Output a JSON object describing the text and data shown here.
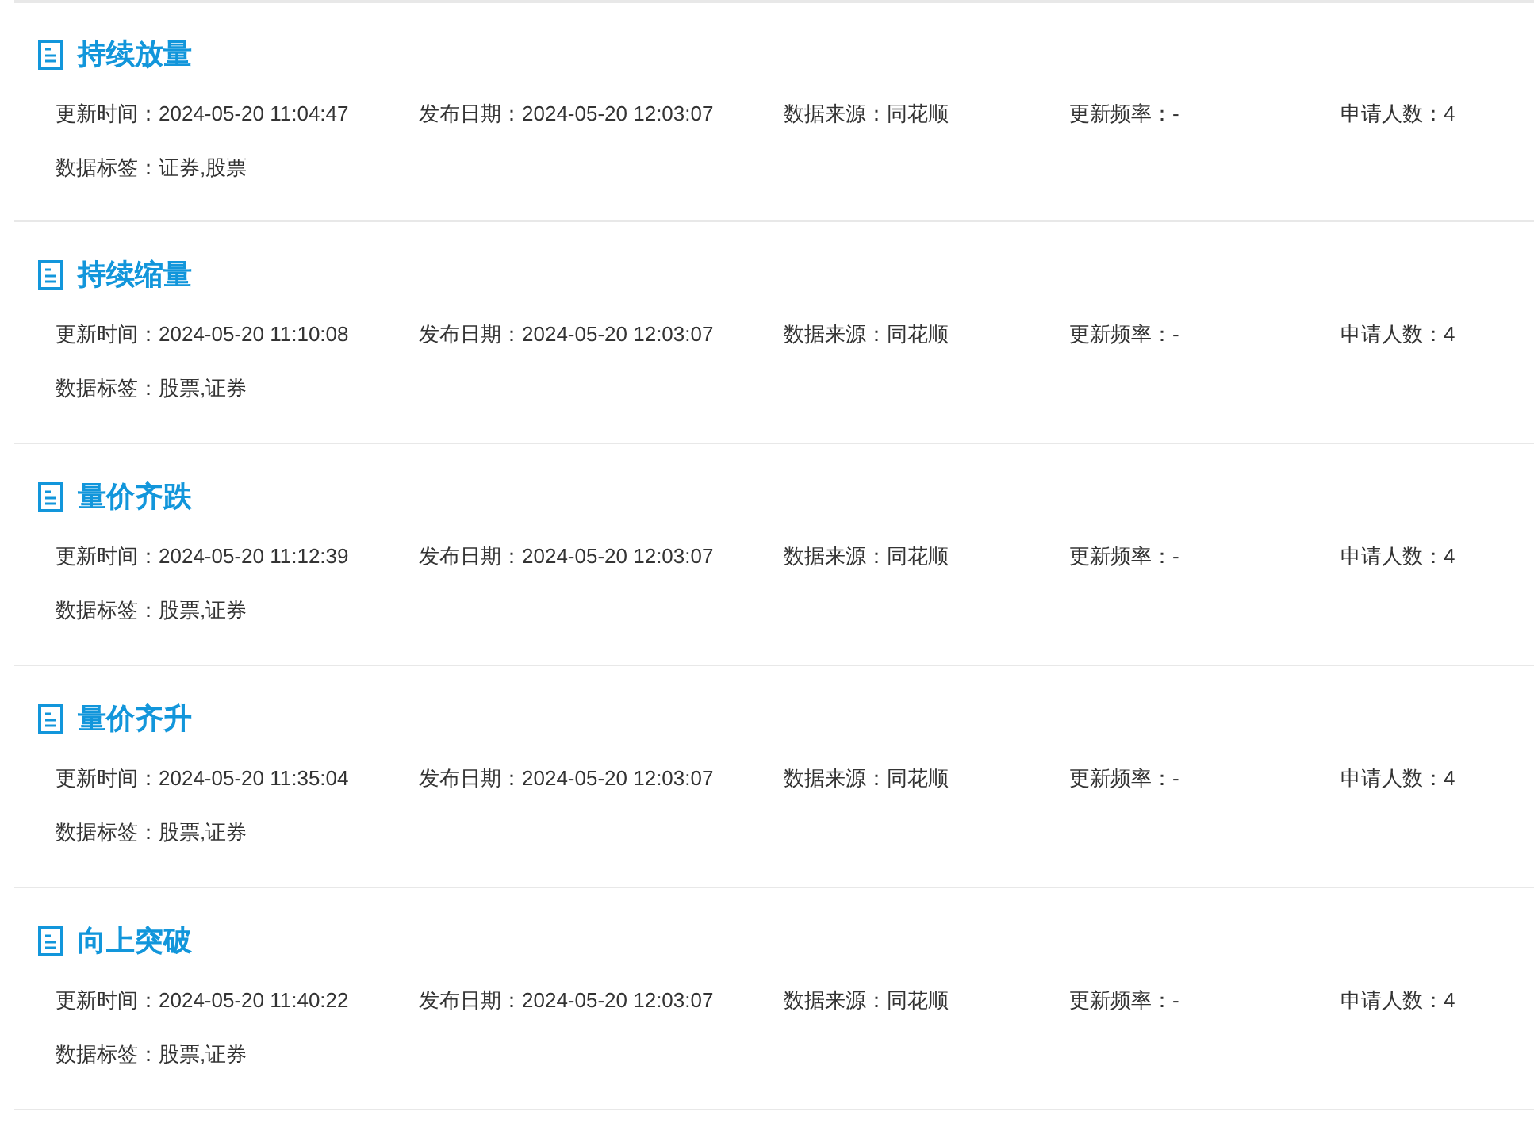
{
  "items": [
    {
      "title": "持续放量",
      "meta": [
        {
          "label": "更新时间：",
          "value": "2024-05-20 11:04:47"
        },
        {
          "label": "发布日期：",
          "value": "2024-05-20 12:03:07"
        },
        {
          "label": "数据来源：",
          "value": "同花顺"
        },
        {
          "label": "更新频率：",
          "value": "-"
        },
        {
          "label": "申请人数：",
          "value": "4"
        }
      ],
      "tags": {
        "label": "数据标签：",
        "value": "证券,股票"
      }
    },
    {
      "title": "持续缩量",
      "meta": [
        {
          "label": "更新时间：",
          "value": "2024-05-20 11:10:08"
        },
        {
          "label": "发布日期：",
          "value": "2024-05-20 12:03:07"
        },
        {
          "label": "数据来源：",
          "value": "同花顺"
        },
        {
          "label": "更新频率：",
          "value": "-"
        },
        {
          "label": "申请人数：",
          "value": "4"
        }
      ],
      "tags": {
        "label": "数据标签：",
        "value": "股票,证券"
      }
    },
    {
      "title": "量价齐跌",
      "meta": [
        {
          "label": "更新时间：",
          "value": "2024-05-20 11:12:39"
        },
        {
          "label": "发布日期：",
          "value": "2024-05-20 12:03:07"
        },
        {
          "label": "数据来源：",
          "value": "同花顺"
        },
        {
          "label": "更新频率：",
          "value": "-"
        },
        {
          "label": "申请人数：",
          "value": "4"
        }
      ],
      "tags": {
        "label": "数据标签：",
        "value": "股票,证券"
      }
    },
    {
      "title": "量价齐升",
      "meta": [
        {
          "label": "更新时间：",
          "value": "2024-05-20 11:35:04"
        },
        {
          "label": "发布日期：",
          "value": "2024-05-20 12:03:07"
        },
        {
          "label": "数据来源：",
          "value": "同花顺"
        },
        {
          "label": "更新频率：",
          "value": "-"
        },
        {
          "label": "申请人数：",
          "value": "4"
        }
      ],
      "tags": {
        "label": "数据标签：",
        "value": "股票,证券"
      }
    },
    {
      "title": "向上突破",
      "meta": [
        {
          "label": "更新时间：",
          "value": "2024-05-20 11:40:22"
        },
        {
          "label": "发布日期：",
          "value": "2024-05-20 12:03:07"
        },
        {
          "label": "数据来源：",
          "value": "同花顺"
        },
        {
          "label": "更新频率：",
          "value": "-"
        },
        {
          "label": "申请人数：",
          "value": "4"
        }
      ],
      "tags": {
        "label": "数据标签：",
        "value": "股票,证券"
      }
    }
  ]
}
